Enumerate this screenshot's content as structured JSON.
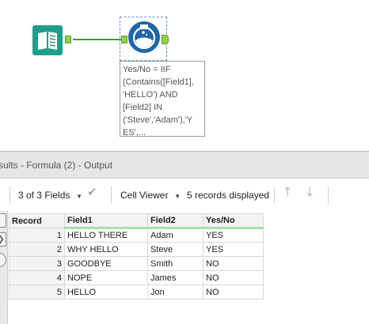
{
  "canvas": {
    "annotation_lines": [
      "Yes/No = IIF",
      "(Contains([Field1],",
      "'HELLO') AND",
      "[Field2] IN",
      "('Steve','Adam'),'Y",
      "ES',..."
    ],
    "connection_color": "#3a9a3a",
    "input_icon": "book-icon",
    "formula_icon": "flask-icon"
  },
  "results": {
    "title": "sults - Formula (2) - Output",
    "fields_label": "3 of 3 Fields",
    "cell_viewer_label": "Cell Viewer",
    "records_label": "5 records displayed",
    "side_icons": [
      "chevron-right-icon",
      "circle-icon"
    ],
    "columns": [
      "Record",
      "Field1",
      "Field2",
      "Yes/No"
    ],
    "rows": [
      {
        "record": "1",
        "field1": "HELLO THERE",
        "field2": "Adam",
        "yesno": "YES"
      },
      {
        "record": "2",
        "field1": "WHY HELLO",
        "field2": "Steve",
        "yesno": "YES"
      },
      {
        "record": "3",
        "field1": "GOODBYE",
        "field2": "Smith",
        "yesno": "NO"
      },
      {
        "record": "4",
        "field1": "NOPE",
        "field2": "James",
        "yesno": "NO"
      },
      {
        "record": "5",
        "field1": "HELLO",
        "field2": "Jon",
        "yesno": "NO"
      }
    ],
    "header_accent": "#a5e3a5"
  }
}
